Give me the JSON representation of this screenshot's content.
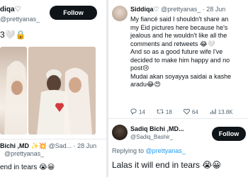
{
  "left": {
    "name": "diqa♡",
    "handle": "@prettyanas_",
    "follow_label": "Follow",
    "body": "3🤍🔒",
    "quote": {
      "name": "Bichi ,MD",
      "name_suffix": "✨💥 @Sad... · 28 Jun",
      "handle": "@prettyanas_",
      "text": "end in tears 😭😀"
    }
  },
  "right": {
    "tweet": {
      "name": "Siddiqa♡",
      "handle_date": "@prettyanas_ · 28 Jun",
      "lines": [
        "My fiancé said I shouldn't share an",
        "my Eid pictures here because he's",
        "jealous and he wouldn't like all the",
        "comments and retweets 😂🤍",
        "And so as a good future wife I've",
        "decided to make him happy and no",
        "post😢",
        "Mudai akan soyayya saidai a kashe",
        "aradu😂😍"
      ],
      "reply_count": "14",
      "retweet_count": "18",
      "like_count": "64",
      "view_count": "13.8K"
    },
    "reply": {
      "name": "Sadiq Bichi ,MD...",
      "handle": "@Sadiq_Bashir_",
      "follow_label": "Follow",
      "replying_to_label": "Replying to",
      "replying_to_handle": "@prettyanas_",
      "text": "Lalas it will end in tears 😭😀"
    }
  },
  "icons": {
    "reply": "comment-icon",
    "retweet": "retweet-icon",
    "like": "heart-icon",
    "views": "chart-icon"
  }
}
